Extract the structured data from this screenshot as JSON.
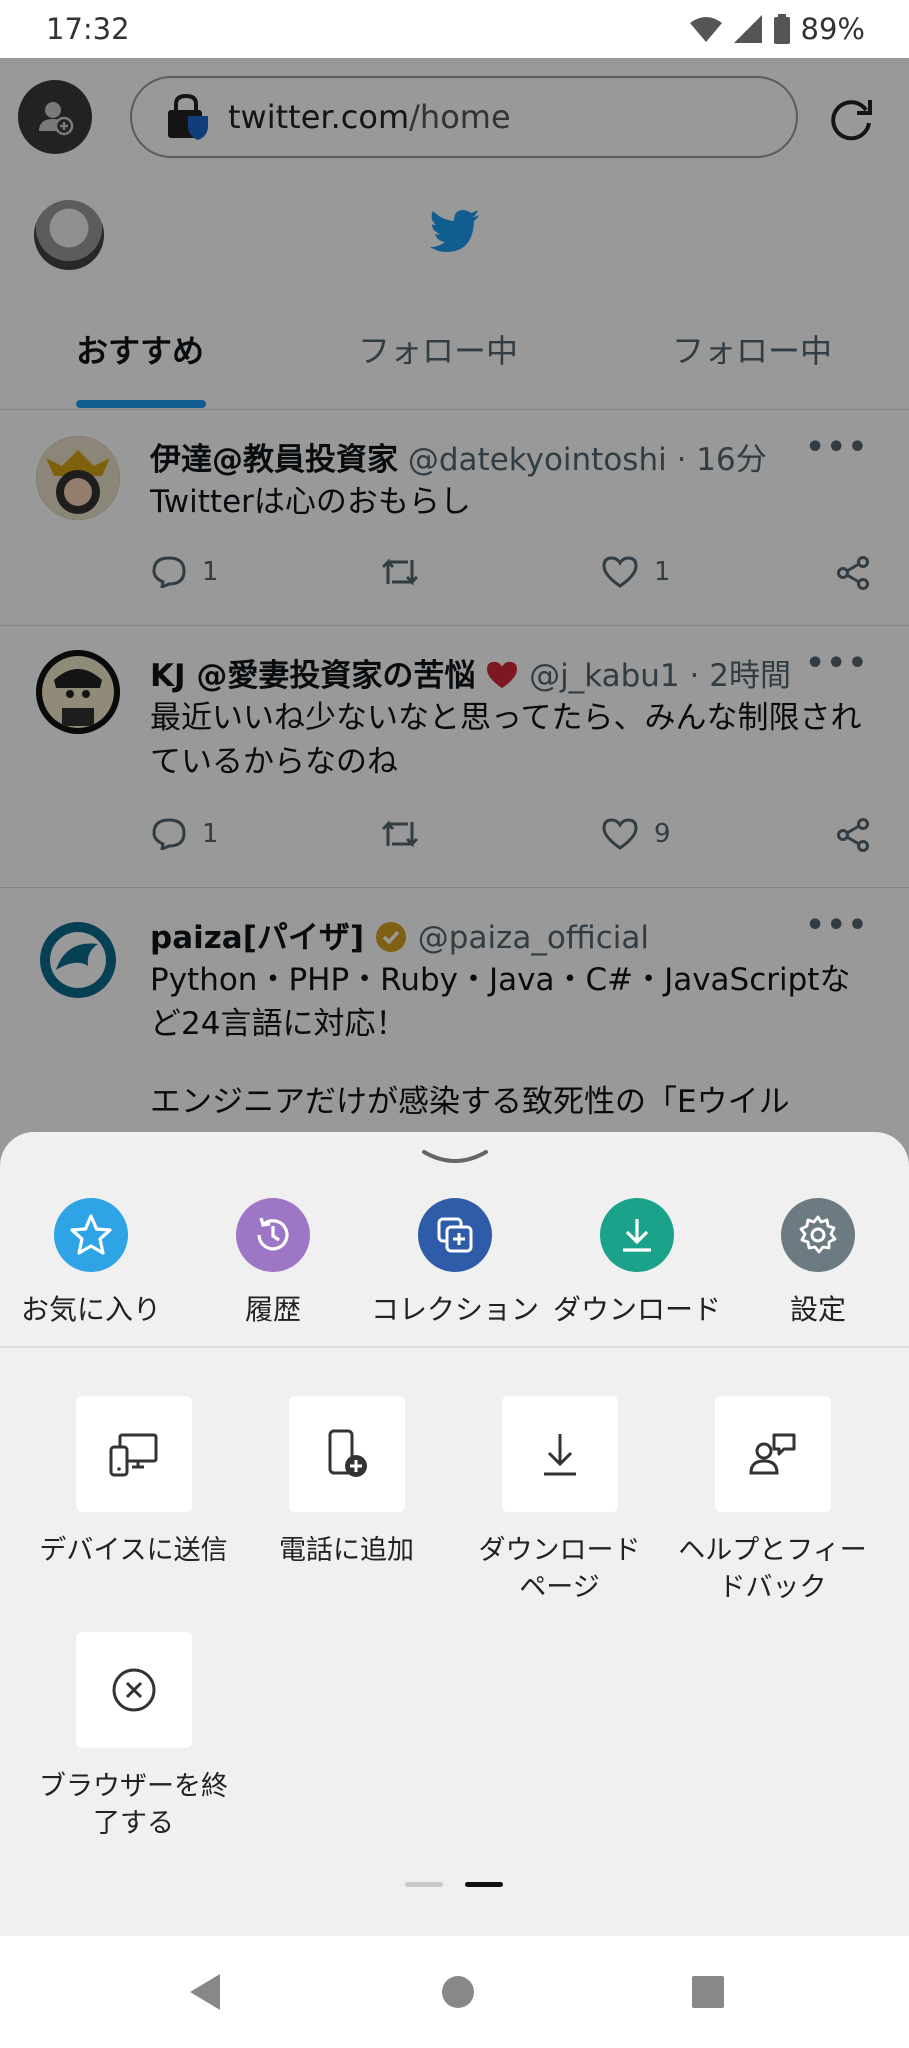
{
  "status": {
    "time": "17:32",
    "battery": "89%"
  },
  "browser": {
    "url_domain": "twitter.com",
    "url_path": "/home"
  },
  "tabs": [
    {
      "label": "おすすめ"
    },
    {
      "label": "フォロー中"
    },
    {
      "label": "フォロー中"
    }
  ],
  "tweets": [
    {
      "name": "伊達@教員投資家",
      "handle": "@datekyointoshi",
      "time": "16分",
      "text": "Twitterは心のおもらし",
      "replies": "1",
      "likes": "1"
    },
    {
      "name": "KJ @愛妻投資家の苦悩",
      "handle": "@j_kabu1",
      "time": "2時間",
      "text": "最近いいね少ないなと思ってたら、みんな制限されているからなのね",
      "replies": "1",
      "likes": "9"
    },
    {
      "name": "paiza[パイザ]",
      "handle": "@paiza_official",
      "time": "",
      "text_line1": "Python・PHP・Ruby・Java・C#・JavaScriptなど24言語に対応！",
      "text_line2": "エンジニアだけが感染する致死性の「Eウイル"
    }
  ],
  "menu": {
    "quick": [
      {
        "label": "お気に入り",
        "icon": "star-icon",
        "color": "#2ea3e6"
      },
      {
        "label": "履歴",
        "icon": "history-icon",
        "color": "#9d76c6"
      },
      {
        "label": "コレクション",
        "icon": "collections-icon",
        "color": "#2e5ca8"
      },
      {
        "label": "ダウンロード",
        "icon": "download-icon",
        "color": "#1aa38a"
      },
      {
        "label": "設定",
        "icon": "gear-icon",
        "color": "#6c7a82"
      }
    ],
    "items": [
      {
        "label": "デバイスに送信",
        "icon": "send-to-device-icon"
      },
      {
        "label": "電話に追加",
        "icon": "add-to-phone-icon"
      },
      {
        "label": "ダウンロードページ",
        "label_line1": "ダウンロード",
        "label_line2": "ページ",
        "icon": "download-page-icon"
      },
      {
        "label_line1": "ヘルプとフィー",
        "label_line2": "ドバック",
        "icon": "help-feedback-icon"
      },
      {
        "label_line1": "ブラウザーを終",
        "label_line2": "了する",
        "icon": "close-browser-icon"
      }
    ],
    "page_index": 2,
    "page_count": 2
  }
}
